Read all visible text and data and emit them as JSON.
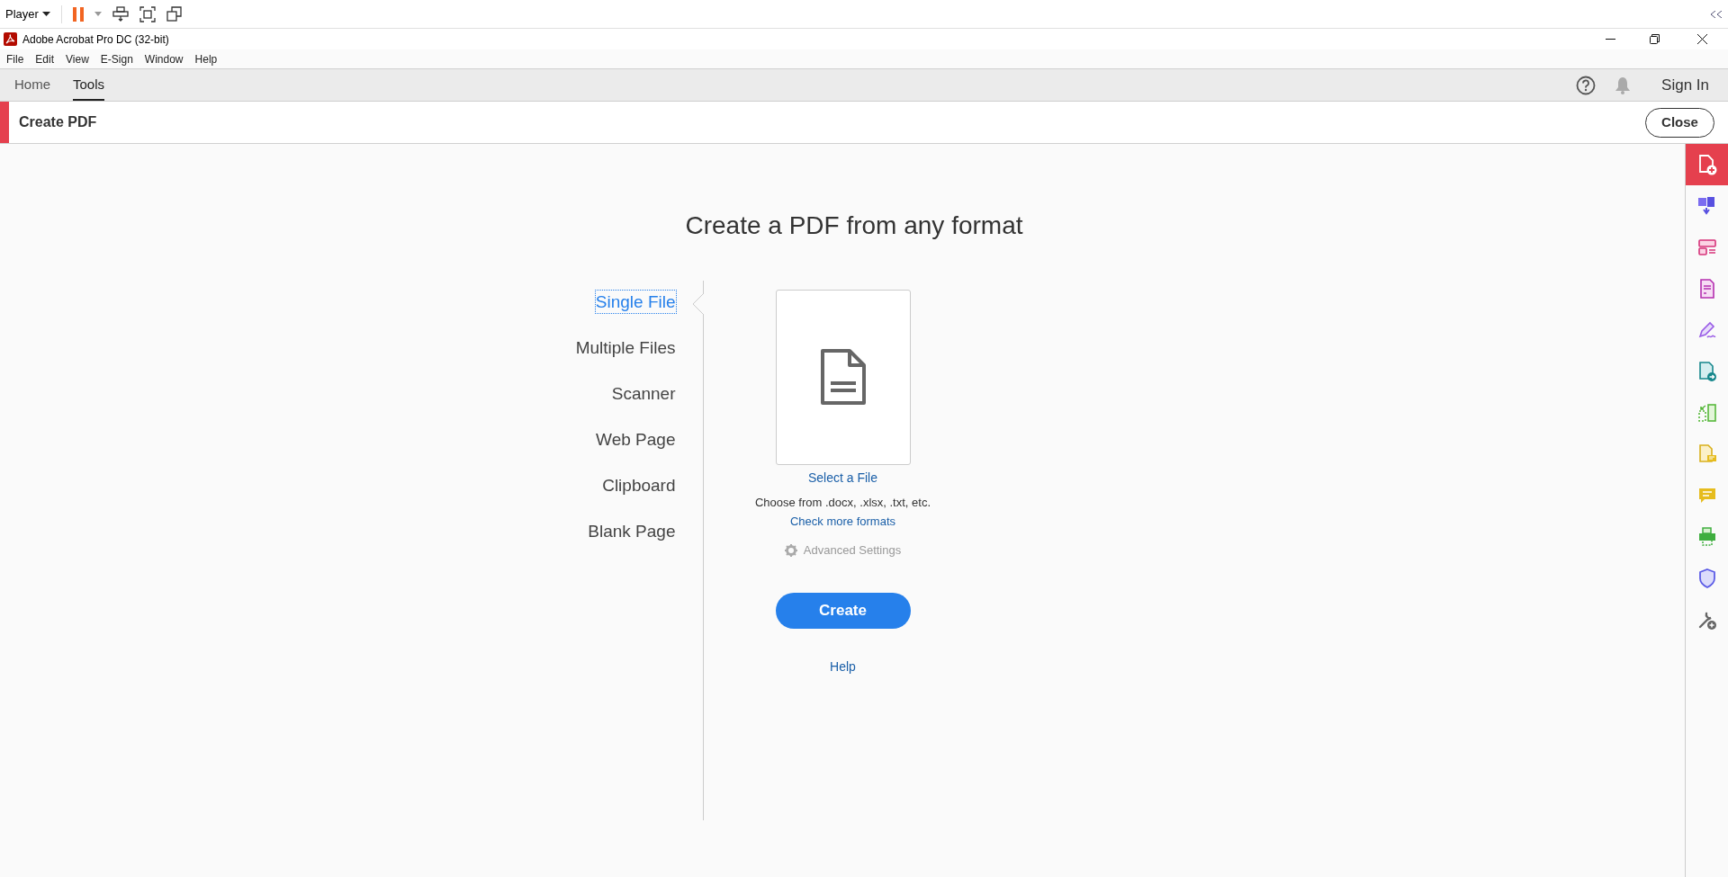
{
  "player_bar": {
    "label": "Player"
  },
  "window": {
    "title": "Adobe Acrobat Pro DC (32-bit)"
  },
  "menu": [
    "File",
    "Edit",
    "View",
    "E-Sign",
    "Window",
    "Help"
  ],
  "tabs": [
    {
      "label": "Home",
      "selected": false
    },
    {
      "label": "Tools",
      "selected": true
    }
  ],
  "account": {
    "sign_in": "Sign In"
  },
  "tool_header": {
    "title": "Create PDF",
    "close": "Close"
  },
  "heading": "Create a PDF from any format",
  "sources": [
    {
      "label": "Single File",
      "selected": true
    },
    {
      "label": "Multiple Files",
      "selected": false
    },
    {
      "label": "Scanner",
      "selected": false
    },
    {
      "label": "Web Page",
      "selected": false
    },
    {
      "label": "Clipboard",
      "selected": false
    },
    {
      "label": "Blank Page",
      "selected": false
    }
  ],
  "file_panel": {
    "select": "Select a File",
    "hint": "Choose from .docx, .xlsx, .txt, etc.",
    "formats_link": "Check more formats",
    "advanced": "Advanced Settings",
    "create": "Create",
    "help": "Help"
  },
  "tool_rail": [
    {
      "kind": "create",
      "selected": true
    },
    {
      "kind": "combine",
      "selected": false
    },
    {
      "kind": "organize",
      "selected": false
    },
    {
      "kind": "form",
      "selected": false
    },
    {
      "kind": "sign",
      "selected": false
    },
    {
      "kind": "export",
      "selected": false
    },
    {
      "kind": "compare",
      "selected": false
    },
    {
      "kind": "annotate",
      "selected": false
    },
    {
      "kind": "comment",
      "selected": false
    },
    {
      "kind": "print",
      "selected": false
    },
    {
      "kind": "protect",
      "selected": false
    },
    {
      "kind": "more",
      "selected": false
    }
  ]
}
